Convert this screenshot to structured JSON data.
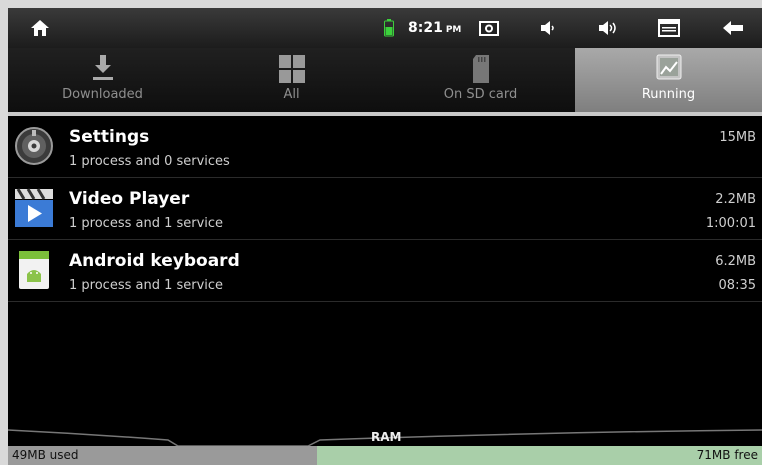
{
  "status_bar": {
    "time": "8:21",
    "ampm": "PM",
    "icons": [
      "home-icon",
      "battery-icon",
      "screenshot-icon",
      "volume-down-icon",
      "volume-up-icon",
      "menu-icon",
      "back-icon"
    ]
  },
  "tabs": [
    {
      "label": "Downloaded",
      "icon": "download-icon",
      "active": false
    },
    {
      "label": "All",
      "icon": "grid-icon",
      "active": false
    },
    {
      "label": "On SD card",
      "icon": "sdcard-icon",
      "active": false
    },
    {
      "label": "Running",
      "icon": "running-icon",
      "active": true
    }
  ],
  "apps": [
    {
      "name": "Settings",
      "subtitle": "1 process and 0 services",
      "size": "15MB",
      "time": "",
      "icon": "settings-icon"
    },
    {
      "name": "Video Player",
      "subtitle": "1 process and 1 service",
      "size": "2.2MB",
      "time": "1:00:01",
      "icon": "video-player-icon"
    },
    {
      "name": "Android keyboard",
      "subtitle": "1 process and 1 service",
      "size": "6.2MB",
      "time": "08:35",
      "icon": "android-keyboard-icon"
    }
  ],
  "ram": {
    "label": "RAM",
    "used": "49MB used",
    "free": "71MB free",
    "used_fraction": 0.41
  },
  "colors": {
    "active_tab": "#9a9a9a",
    "ram_free": "#a9cfa9",
    "battery": "#3cd13c"
  }
}
